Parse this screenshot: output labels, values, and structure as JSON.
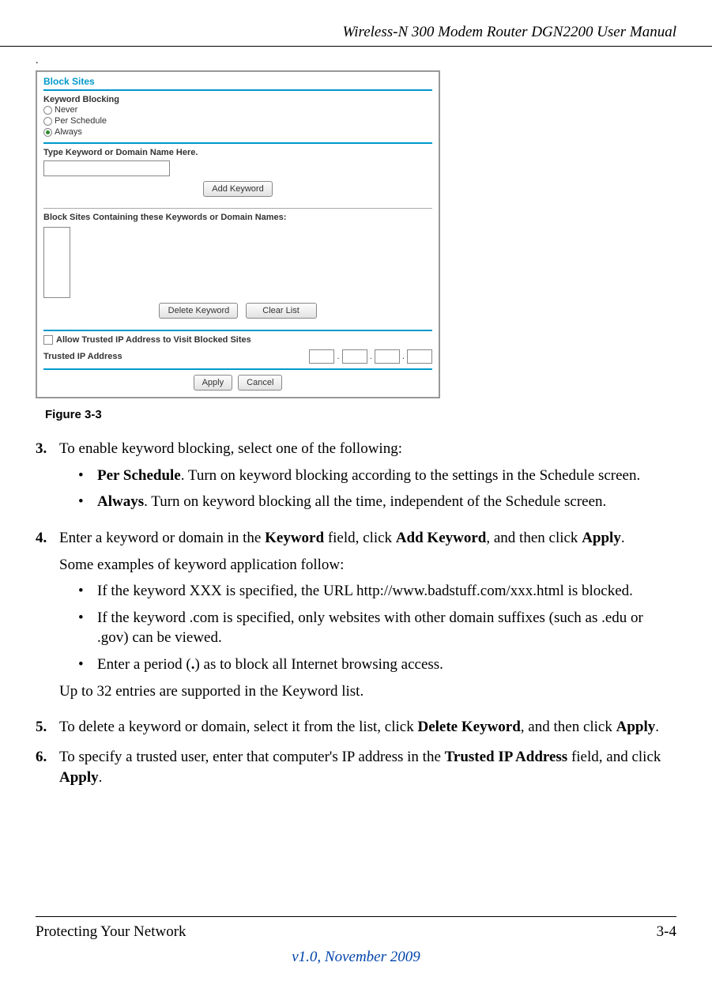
{
  "header": {
    "doc_title": "Wireless-N 300 Modem Router DGN2200 User Manual"
  },
  "figure": {
    "title": "Block Sites",
    "keyword_blocking_label": "Keyword Blocking",
    "radio_never": "Never",
    "radio_per_schedule": "Per Schedule",
    "radio_always": "Always",
    "type_keyword_label": "Type Keyword or Domain Name Here.",
    "add_keyword_btn": "Add Keyword",
    "block_list_label": "Block Sites Containing these Keywords or Domain Names:",
    "delete_keyword_btn": "Delete Keyword",
    "clear_list_btn": "Clear List",
    "allow_trusted_label": "Allow Trusted IP Address to Visit Blocked Sites",
    "trusted_ip_label": "Trusted IP Address",
    "apply_btn": "Apply",
    "cancel_btn": "Cancel",
    "caption": "Figure 3-3"
  },
  "steps": {
    "s3": {
      "num": "3.",
      "text": "To enable keyword blocking, select one of the following:",
      "b1": {
        "bold": "Per Schedule",
        "rest": ". Turn on keyword blocking according to the settings in the Schedule screen."
      },
      "b2": {
        "bold": "Always",
        "rest": ". Turn on keyword blocking all the time, independent of the Schedule screen."
      }
    },
    "s4": {
      "num": "4.",
      "p1a": "Enter a keyword or domain in the ",
      "p1b": "Keyword",
      "p1c": " field, click ",
      "p1d": "Add Keyword",
      "p1e": ", and then click ",
      "p1f": "Apply",
      "p1g": ".",
      "p2": "Some examples of keyword application follow:",
      "b1": "If the keyword XXX is specified, the URL http://www.badstuff.com/xxx.html is blocked.",
      "b2": "If the keyword .com is specified, only websites with other domain suffixes (such as .edu or .gov) can be viewed.",
      "b3a": "Enter a period (",
      "b3b": ".",
      "b3c": ") as to block all Internet browsing access.",
      "p3": "Up to 32 entries are supported in the Keyword list."
    },
    "s5": {
      "num": "5.",
      "t1": "To delete a keyword or domain, select it from the list, click ",
      "t2": "Delete Keyword",
      "t3": ", and then click ",
      "t4": "Apply",
      "t5": "."
    },
    "s6": {
      "num": "6.",
      "t1": "To specify a trusted user, enter that computer's IP address in the ",
      "t2": "Trusted IP Address",
      "t3": " field, and click ",
      "t4": "Apply",
      "t5": "."
    }
  },
  "footer": {
    "section": "Protecting Your Network",
    "page": "3-4",
    "version": "v1.0, November 2009"
  }
}
